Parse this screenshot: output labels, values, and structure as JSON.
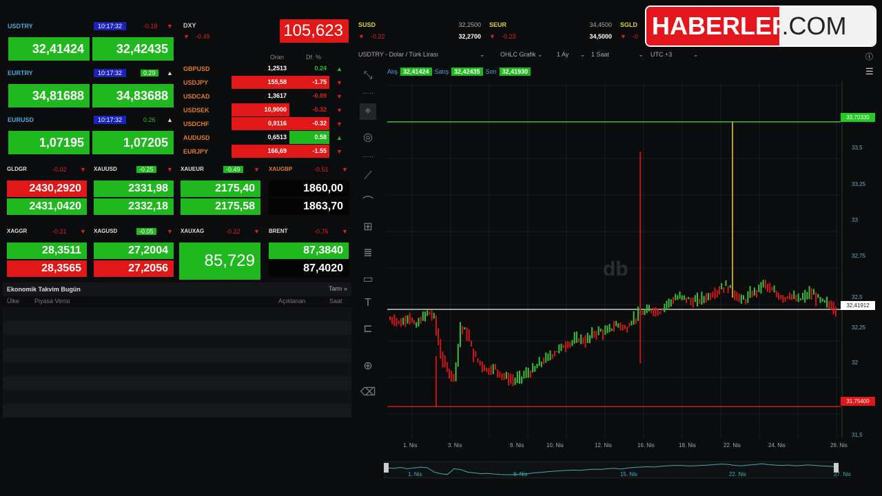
{
  "fx_tiles": [
    {
      "symbol": "USDTRY",
      "time": "10:17:32",
      "change": "-0.18",
      "dir": "down",
      "bid": "32,41424",
      "ask": "32,42435"
    },
    {
      "symbol": "EURTRY",
      "time": "10:17:32",
      "change": "0.29",
      "dir": "up",
      "bid": "34,81688",
      "ask": "34,83688"
    },
    {
      "symbol": "EURUSD",
      "time": "10:17:32",
      "change": "0.26",
      "dir": "up",
      "bid": "1,07195",
      "ask": "1,07205"
    }
  ],
  "dxy": {
    "symbol": "DXY",
    "change": "-0.49",
    "value": "105,623"
  },
  "cross_table": {
    "col_price": "Oran",
    "col_change": "Df. %",
    "rows": [
      {
        "symbol": "GBPUSD",
        "price": "1,2513",
        "change": "0.24",
        "dir": "up"
      },
      {
        "symbol": "USDJPY",
        "price": "155,58",
        "change": "-1.75",
        "dir": "down"
      },
      {
        "symbol": "USDCAD",
        "price": "1,3617",
        "change": "-0.09",
        "dir": "down"
      },
      {
        "symbol": "USDSEK",
        "price": "10,9000",
        "change": "-0.32",
        "dir": "down"
      },
      {
        "symbol": "USDCHF",
        "price": "0,9116",
        "change": "-0.32",
        "dir": "down"
      },
      {
        "symbol": "AUDUSD",
        "price": "0,6513",
        "change": "0.58",
        "dir": "up"
      },
      {
        "symbol": "EURJPY",
        "price": "166,69",
        "change": "-1.55",
        "dir": "down"
      }
    ]
  },
  "metals": [
    {
      "symbol": "GLDGR",
      "change": "-0.02",
      "bid": "2430,2920",
      "ask": "2431,0420"
    },
    {
      "symbol": "XAUUSD",
      "change": "-0.25",
      "bid": "2331,98",
      "ask": "2332,18"
    },
    {
      "symbol": "XAUEUR",
      "change": "-0.49",
      "bid": "2175,40",
      "ask": "2175,58"
    },
    {
      "symbol": "XAUGBP",
      "change": "-0.51",
      "bid": "1860,00",
      "ask": "1863,70"
    },
    {
      "symbol": "XAGGR",
      "change": "-0.21",
      "bid": "28,3511",
      "ask": "28,3565"
    },
    {
      "symbol": "XAGUSD",
      "change": "-0.05",
      "bid": "27,2004",
      "ask": "27,2056"
    },
    {
      "symbol": "XAUXAG",
      "change": "-0.22",
      "value": "85,729"
    },
    {
      "symbol": "BRENT",
      "change": "-0.75",
      "bid": "87,3840",
      "ask": "87,4020"
    }
  ],
  "calendar": {
    "title": "Ekonomik Takvim Bugün",
    "all": "Tamı »",
    "cols": [
      "Ülke",
      "Piyasa Verisi",
      "Açıklanan",
      "Saat"
    ]
  },
  "top_quotes": [
    {
      "symbol": "SUSD",
      "change": "-0.22",
      "bid": "32,2500",
      "ask": "32,2700"
    },
    {
      "symbol": "SEUR",
      "change": "-0.23",
      "bid": "34,4500",
      "ask": "34,5000"
    },
    {
      "symbol": "SGLD",
      "change": "-0"
    }
  ],
  "logo": {
    "left": "HABERLER",
    "right": ".COM"
  },
  "chart_toolbar": {
    "instrument": "USDTRY - Dolar / Türk Lirası",
    "type": "OHLC Grafik",
    "range": "1 Ay",
    "interval": "1 Saat",
    "tz": "UTC +3"
  },
  "quote_bar": {
    "bid_label": "Alış",
    "bid": "32,41424",
    "ask_label": "Satış",
    "ask": "32,42435",
    "last_label": "Son",
    "last": "32,41930"
  },
  "chart_data": {
    "type": "candlestick",
    "ylim": [
      31.5,
      33.75
    ],
    "y_ticks": [
      "33,5",
      "33,25",
      "33",
      "32,75",
      "32,5",
      "32,25",
      "32",
      "31,5"
    ],
    "x_ticks": [
      "1. Nis",
      "3. Nis",
      "8. Nis",
      "10. Nis",
      "12. Nis",
      "16. Nis",
      "18. Nis",
      "22. Nis",
      "24. Nis",
      "26. Nis"
    ],
    "high_line": {
      "value": 33.7033,
      "label": "33,70330"
    },
    "low_line": {
      "value": 31.754,
      "label": "31,75400"
    },
    "current": {
      "value": 32.41912,
      "label": "32,41912"
    },
    "closes": [
      32.35,
      32.32,
      32.38,
      32.3,
      32.35,
      32.4,
      32.36,
      32.1,
      32.0,
      31.95,
      32.3,
      32.25,
      32.1,
      32.05,
      32.0,
      32.02,
      31.98,
      31.95,
      31.93,
      31.95,
      31.98,
      32.0,
      32.05,
      32.08,
      32.12,
      32.15,
      32.18,
      32.2,
      32.22,
      32.2,
      32.25,
      32.27,
      32.26,
      32.3,
      32.32,
      32.28,
      32.35,
      32.38,
      32.4,
      32.42,
      32.4,
      32.45,
      32.48,
      32.5,
      32.5,
      32.47,
      32.48,
      32.5,
      32.52,
      32.55,
      32.58,
      32.56,
      32.5,
      32.48,
      32.52,
      32.55,
      32.6,
      32.55,
      32.52,
      32.5,
      32.52,
      32.48,
      32.5,
      32.53,
      32.5,
      32.47,
      32.45,
      32.42
    ],
    "spikes": [
      {
        "index": 7,
        "low": 31.754
      },
      {
        "index": 38,
        "high": 33.5,
        "low": 32.05
      },
      {
        "index": 52,
        "high": 33.7033
      }
    ],
    "navigator_labels": [
      "1. Nis",
      "8. Nis",
      "15. Nis",
      "22. Nis",
      "27. Nis"
    ]
  }
}
